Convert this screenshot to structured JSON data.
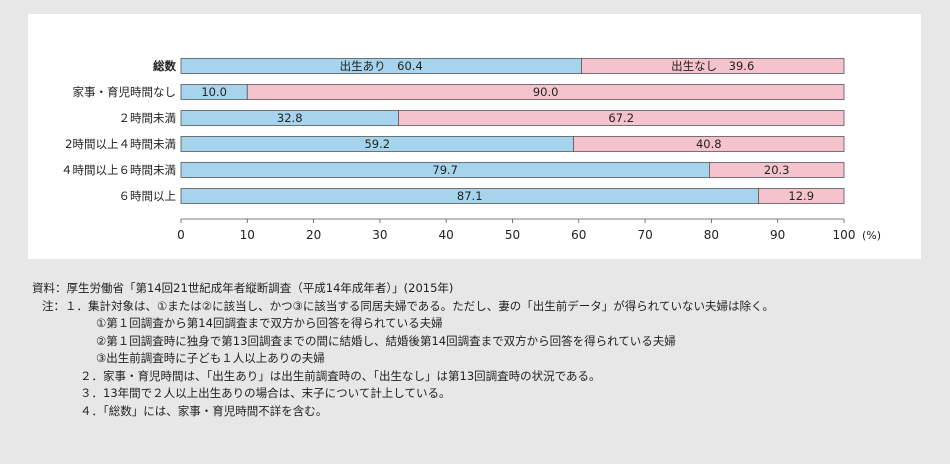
{
  "chart_data": {
    "type": "bar",
    "orientation": "horizontal",
    "stacked": true,
    "percent_unit": "(%)",
    "categories": [
      "総数",
      "家事・育児時間なし",
      "２時間未満",
      "2時間以上４時間未満",
      "４時間以上６時間未満",
      "６時間以上"
    ],
    "series": [
      {
        "name": "出生あり",
        "color": "#a6d4ec",
        "values": [
          60.4,
          10.0,
          32.8,
          59.2,
          79.7,
          87.1
        ],
        "labels": [
          "出生あり　60.4",
          "10.0",
          "32.8",
          "59.2",
          "79.7",
          "87.1"
        ]
      },
      {
        "name": "出生なし",
        "color": "#f5c3cd",
        "values": [
          39.6,
          90.0,
          67.2,
          40.8,
          20.3,
          12.9
        ],
        "labels": [
          "出生なし　39.6",
          "90.0",
          "67.2",
          "40.8",
          "20.3",
          "12.9"
        ]
      }
    ],
    "xlim": [
      0,
      100
    ],
    "xticks": [
      "0",
      "10",
      "20",
      "30",
      "40",
      "50",
      "60",
      "70",
      "80",
      "90",
      "100"
    ],
    "grid": false,
    "legend": "none"
  },
  "notes": {
    "source": "資料：厚生労働省「第14回21世紀成年者縦断調査（平成14年成年者）」(2015年)",
    "lines": [
      "注：１．集計対象は、①または②に該当し、かつ③に該当する同居夫婦である。ただし、妻の「出生前データ」が得られていない夫婦は除く。",
      "①第１回調査から第14回調査まで双方から回答を得られている夫婦",
      "②第１回調査時に独身で第13回調査までの間に結婚し、結婚後第14回調査まで双方から回答を得られている夫婦",
      "③出生前調査時に子ども１人以上ありの夫婦",
      "２．家事・育児時間は、「出生あり」は出生前調査時の、「出生なし」は第13回調査時の状況である。",
      "３．13年間で２人以上出生ありの場合は、末子について計上している。",
      "４．「総数」には、家事・育児時間不詳を含む。"
    ]
  }
}
